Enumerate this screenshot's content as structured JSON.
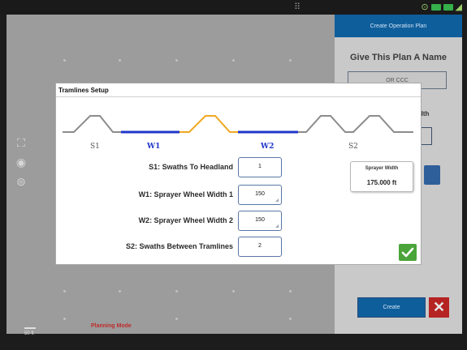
{
  "status_bar": {
    "center_icon": "grid-icon",
    "right_icons": [
      "sync-icon",
      "signal-icon",
      "battery-icon",
      "wifi-icon"
    ]
  },
  "map": {
    "side_icons": [
      "fit-map-icon",
      "center-vehicle-icon",
      "layers-icon"
    ],
    "scale_label": "50 ft",
    "mode_label": "Planning Mode"
  },
  "right_panel": {
    "header": "Create Operation Plan",
    "title": "Give This Plan A Name",
    "plan_name_value": "OR CCC",
    "partial_label": "dth"
  },
  "footer": {
    "create_label": "Create",
    "close_icon": "close-icon"
  },
  "dialog": {
    "title": "Tramlines Setup",
    "diagram": {
      "labels": [
        "S1",
        "W1",
        "W2",
        "S2"
      ],
      "colors": {
        "profile": "#8c8c8c",
        "wheel": "#1f35c8",
        "tramline": "#f0a820"
      }
    },
    "rows": [
      {
        "label": "S1: Swaths To Headland",
        "value": "1"
      },
      {
        "label": "W1: Sprayer Wheel Width 1",
        "value": "150"
      },
      {
        "label": "W2: Sprayer Wheel Width 2",
        "value": "150"
      },
      {
        "label": "S2: Swaths Between Tramlines",
        "value": "2"
      }
    ],
    "sprayer_width": {
      "title": "Sprayer Width",
      "value": "175.000 ft"
    },
    "ok_icon": "checkmark-icon"
  },
  "colors": {
    "accent": "#0f5e9c",
    "ok": "#4aa43a",
    "danger": "#b52322",
    "input_border": "#5a77a6"
  }
}
